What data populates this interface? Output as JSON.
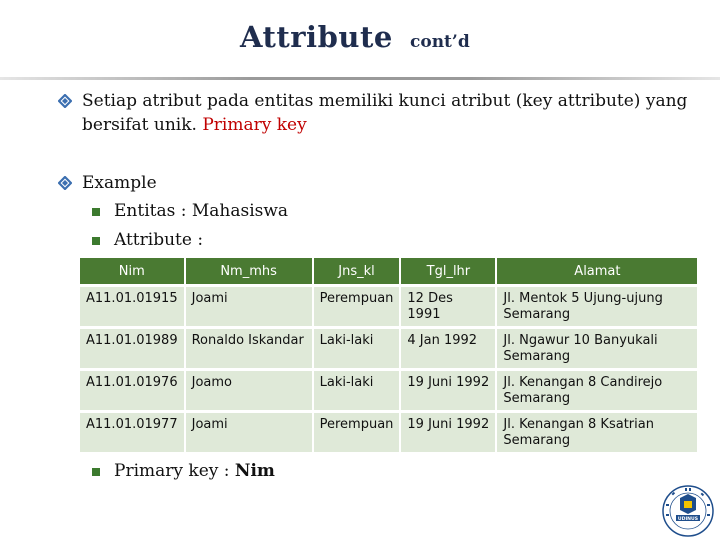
{
  "header": {
    "title": "Attribute",
    "subtitle": "cont’d"
  },
  "bullets": [
    {
      "line1": "Setiap atribut pada entitas memiliki kunci atribut (key attribute) yang",
      "line2_prefix": "bersifat unik. ",
      "line2_highlight": "Primary key"
    },
    {
      "text": "Example"
    }
  ],
  "sub_bullets": [
    "Entitas : Mahasiswa",
    "Attribute :"
  ],
  "table": {
    "headers": [
      "Nim",
      "Nm_mhs",
      "Jns_kl",
      "Tgl_lhr",
      "Alamat"
    ],
    "rows": [
      [
        "A11.01.01915",
        "Joami",
        "Perempuan",
        "12 Des 1991",
        "Jl. Mentok 5 Ujung-ujung Semarang"
      ],
      [
        "A11.01.01989",
        "Ronaldo Iskandar",
        "Laki-laki",
        "4 Jan 1992",
        "Jl. Ngawur 10 Banyukali Semarang"
      ],
      [
        "A11.01.01976",
        "Joamo",
        "Laki-laki",
        "19 Juni 1992",
        "Jl. Kenangan 8 Candirejo Semarang"
      ],
      [
        "A11.01.01977",
        "Joami",
        "Perempuan",
        "19 Juni 1992",
        "Jl. Kenangan 8 Ksatrian Semarang"
      ]
    ]
  },
  "footer_bullet": {
    "prefix": "Primary key : ",
    "key": "Nim"
  },
  "logo": {
    "text": "UDINUS",
    "icon": "university-logo-icon"
  },
  "colors": {
    "title": "#1f2d4e",
    "highlight": "#c00000",
    "table_header": "#4a7a32",
    "table_cell": "#dfe9d8",
    "bullet": "#3c7a2e"
  }
}
